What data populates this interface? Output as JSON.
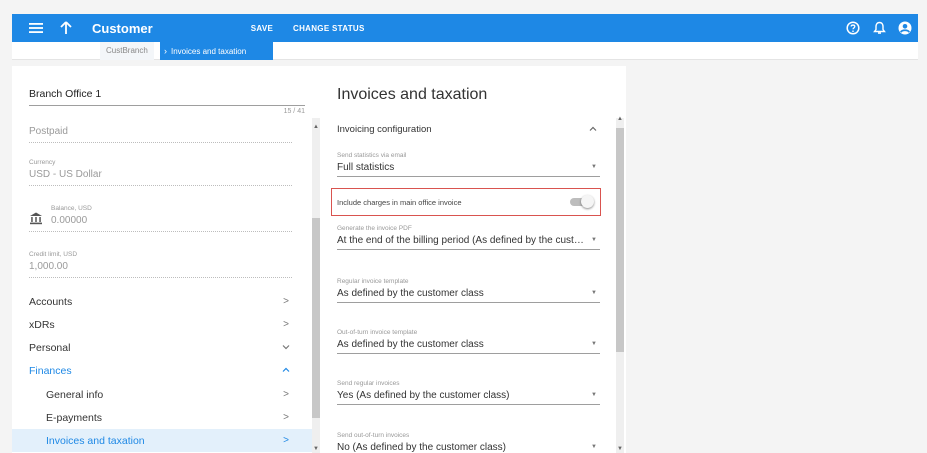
{
  "header": {
    "title": "Customer",
    "save_label": "SAVE",
    "change_status_label": "CHANGE STATUS",
    "icons": [
      "menu-icon",
      "arrow-up-icon",
      "help-icon",
      "bell-icon",
      "account-icon"
    ]
  },
  "breadcrumb": {
    "items": [
      "CustBranch",
      "Invoices and taxation"
    ]
  },
  "left": {
    "name_value": "Branch Office 1",
    "name_counter": "15 / 41",
    "billing_type": "Postpaid",
    "currency_label": "Currency",
    "currency_value": "USD - US Dollar",
    "balance_label": "Balance, USD",
    "balance_value": "0.00000",
    "credit_label": "Credit limit, USD",
    "credit_value": "1,000.00",
    "nav": [
      {
        "label": "Accounts"
      },
      {
        "label": "xDRs"
      },
      {
        "label": "Personal"
      },
      {
        "label": "Finances"
      },
      {
        "label": "General info"
      },
      {
        "label": "E-payments"
      },
      {
        "label": "Invoices and taxation"
      }
    ]
  },
  "main": {
    "title": "Invoices and taxation",
    "section_title": "Invoicing configuration",
    "fields": [
      {
        "label": "Send statistics via email",
        "value": "Full statistics"
      },
      {
        "label": "Generate the invoice PDF",
        "value": "At the end of the billing period (As defined by the customer class)"
      },
      {
        "label": "Regular invoice template",
        "value": "As defined by the customer class"
      },
      {
        "label": "Out-of-turn invoice template",
        "value": "As defined by the customer class"
      },
      {
        "label": "Send regular invoices",
        "value": "Yes (As defined by the customer class)"
      },
      {
        "label": "Send out-of-turn invoices",
        "value": "No (As defined by the customer class)"
      }
    ],
    "toggle": {
      "label": "Include charges in main office invoice",
      "on": false
    }
  },
  "colors": {
    "accent": "#1e88e5",
    "highlight_border": "#d9534f",
    "selected_bg": "#e3f0fb"
  }
}
